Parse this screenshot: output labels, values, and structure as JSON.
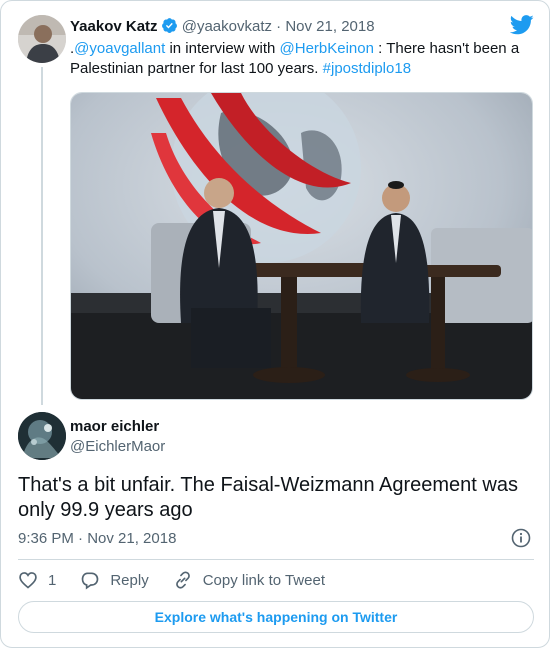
{
  "quoted_tweet": {
    "author_name": "Yaakov Katz",
    "author_handle": "@yaakovkatz",
    "separator": "·",
    "date": "Nov 21, 2018",
    "text_prefix": ".",
    "mention1": "@yoavgallant",
    "text_mid1": " in interview with ",
    "mention2": "@HerbKeinon",
    "text_mid2": " : There hasn't been a Palestinian partner for last 100 years. ",
    "hashtag": "#jpostdiplo18"
  },
  "reply_tweet": {
    "author_name": "maor eichler",
    "author_handle": "@EichlerMaor",
    "text": "That's a bit unfair. The Faisal-Weizmann Agreement was only 99.9 years ago",
    "timestamp": "9:36 PM · Nov 21, 2018"
  },
  "actions": {
    "like_count": "1",
    "reply_label": "Reply",
    "copy_link_label": "Copy link to Tweet"
  },
  "explore_label": "Explore what's happening on Twitter",
  "colors": {
    "accent": "#1d9bf0",
    "secondary_text": "#536471",
    "border": "#cfd9de"
  }
}
